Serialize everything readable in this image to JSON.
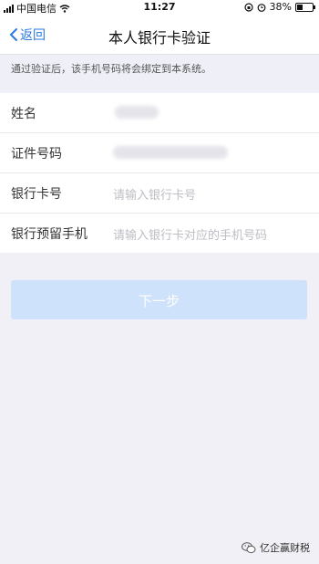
{
  "status_bar": {
    "carrier": "中国电信",
    "time": "11:27",
    "battery": "38%",
    "battery_level": 0.38
  },
  "nav": {
    "back_label": "返回",
    "title": "本人银行卡验证"
  },
  "notice": "通过验证后，该手机号码将会绑定到本系统。",
  "form": {
    "rows": [
      {
        "label": "姓名",
        "value": ""
      },
      {
        "label": "证件号码",
        "value": ""
      },
      {
        "label": "银行卡号",
        "placeholder": "请输入银行卡号"
      },
      {
        "label": "银行预留手机",
        "placeholder": "请输入银行卡对应的手机号码"
      }
    ]
  },
  "next_button": "下一步",
  "watermark": "亿企赢财税",
  "colors": {
    "accent": "#2a7ae2",
    "button_disabled": "#cfe2fb"
  }
}
